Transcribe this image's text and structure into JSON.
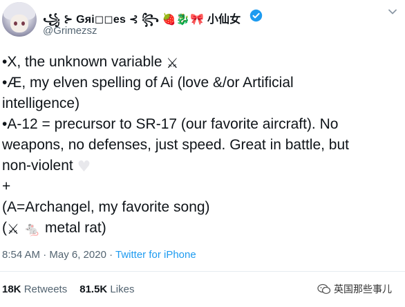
{
  "header": {
    "display_name": "꧁ ⊱ Gяi◻◻es ⊰ ꧂ 🍓🐉🎀 小仙女",
    "handle": "@Grimezsz",
    "icons": [
      "avatar",
      "verified-badge-icon",
      "chevron-down-icon"
    ],
    "verified_color": "#1d9bf0"
  },
  "tweet": {
    "lines": [
      {
        "text": "•X, the unknown variable ",
        "emoji": "⚔"
      },
      {
        "text": "•Æ, my elven spelling of Ai (love &/or Artificial",
        "emoji": ""
      },
      {
        "text": "intelligence)",
        "emoji": ""
      },
      {
        "text": "•A-12 = precursor to SR-17 (our favorite aircraft).  No",
        "emoji": ""
      },
      {
        "text": "weapons, no defenses, just speed.  Great in battle, but",
        "emoji": ""
      },
      {
        "text": "non-violent ",
        "emoji": "🤍"
      },
      {
        "text": "+",
        "emoji": ""
      },
      {
        "text": "(A=Archangel, my favorite song)",
        "emoji": ""
      },
      {
        "text": "(",
        "emoji": "⚔ 🐁",
        "text_after": " metal rat)"
      }
    ]
  },
  "meta": {
    "time": "8:54 AM · May 6, 2020 · ",
    "source": "Twitter for iPhone"
  },
  "stats": {
    "retweets_count": "18K",
    "retweets_label": " Retweets",
    "likes_count": "81.5K",
    "likes_label": " Likes"
  },
  "watermark": {
    "text": "英国那些事儿"
  }
}
